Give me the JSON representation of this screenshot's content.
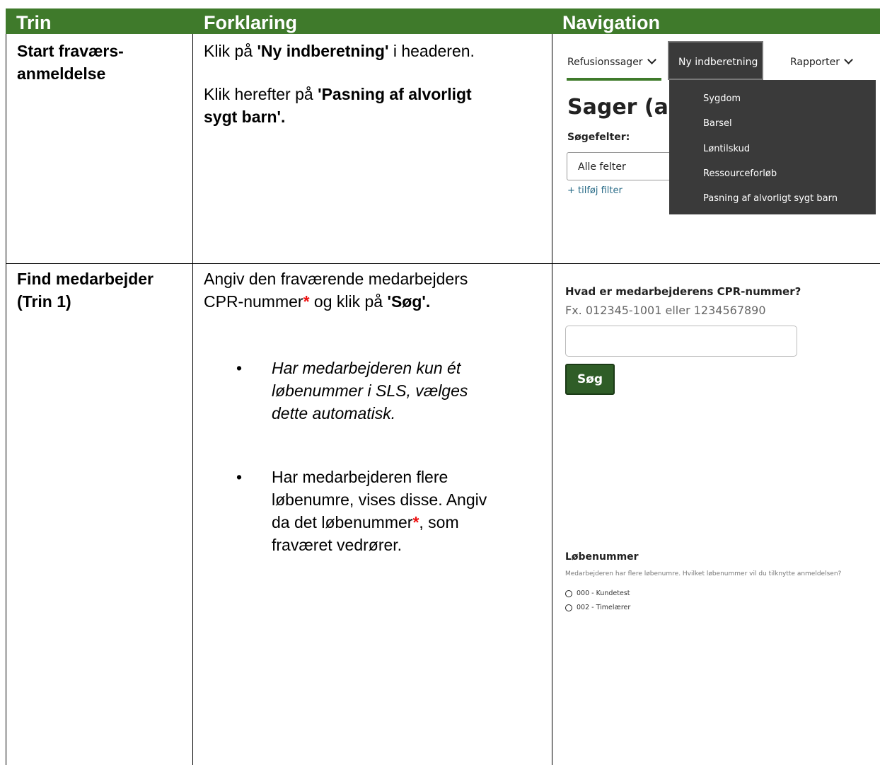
{
  "table": {
    "headers": [
      "Trin",
      "Forklaring",
      "Navigation"
    ],
    "rows": [
      {
        "trin": [
          "Start fraværs-",
          "anmeldelse"
        ],
        "forklaring": {
          "p1_pre": "Klik på ",
          "p1_bold": "'Ny indberetning'",
          "p1_post": " i headeren.",
          "p2_pre": "Klik herefter på ",
          "p2_bold_line1": "'Pasning af alvorligt",
          "p2_bold_line2": "sygt barn'."
        }
      },
      {
        "trin": [
          "Find medarbejder",
          "(Trin 1)"
        ],
        "forklaring": {
          "p1_line1": "Angiv den fraværende medarbejders",
          "p1_cpr": "CPR-nummer",
          "asterisk": "*",
          "p1_mid": " og klik på ",
          "p1_bold": "'Søg'.",
          "bullet_char": "•",
          "bullet1": [
            "Har medarbejderen kun ét",
            "løbenummer i SLS, vælges",
            "dette automatisk."
          ],
          "bullet2_line1": "Har medarbejderen flere",
          "bullet2_line2": "løbenumre, vises disse. Angiv",
          "bullet2_line3_pre": "da det løbenummer",
          "bullet2_line3_post": ", som",
          "bullet2_line4": "fraværet vedrører."
        }
      }
    ]
  },
  "nav1": {
    "tabs": [
      "Refusionssager",
      "Ny indberetning",
      "Rapporter"
    ],
    "page_title": "Sager (akt",
    "search_label": "Søgefelter:",
    "search_select": "Alle felter",
    "add_filter": "+ tilføj filter",
    "dropdown_items": [
      "Sygdom",
      "Barsel",
      "Løntilskud",
      "Ressourceforløb",
      "Pasning af alvorligt sygt barn"
    ]
  },
  "nav2": {
    "cpr_question": "Hvad er medarbejderens CPR-nummer?",
    "cpr_hint": "Fx. 012345-1001 eller 1234567890",
    "search_button": "Søg",
    "lobenummer_title": "Løbenummer",
    "lobenummer_desc": "Medarbejderen har flere løbenumre. Hvilket løbenummer vil du tilknytte anmeldelsen?",
    "options": [
      "000 - Kundetest",
      "002 - Timelærer"
    ]
  },
  "colors": {
    "header_green": "#3f7a2b",
    "button_green": "#2f5d27",
    "dropdown_bg": "#3a3a3a",
    "asterisk_red": "#e11111"
  }
}
